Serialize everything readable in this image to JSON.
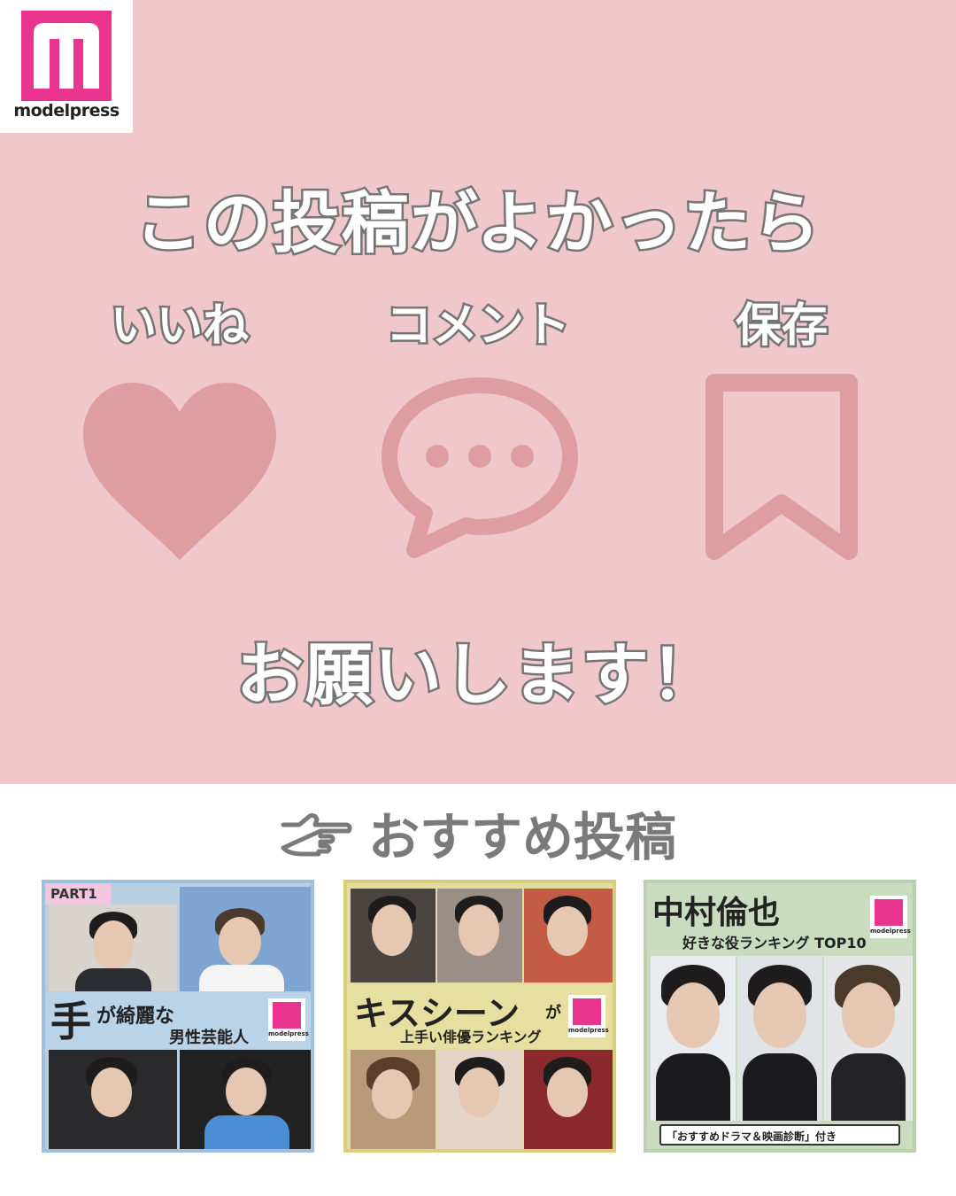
{
  "brand": {
    "logo_text": "modelpress",
    "accent": "#e8348f"
  },
  "cta": {
    "headline": "この投稿がよかったら",
    "actions": [
      {
        "label": "いいね",
        "icon": "heart-icon"
      },
      {
        "label": "コメント",
        "icon": "speech-bubble-icon"
      },
      {
        "label": "保存",
        "icon": "bookmark-icon"
      }
    ],
    "closing": "お願いします！"
  },
  "recommended": {
    "title": "おすすめ投稿",
    "icon": "pointing-hand-icon",
    "posts": [
      {
        "tag": "PART1",
        "title_big": "手",
        "title_rest": "が綺麗な",
        "subtitle": "男性芸能人"
      },
      {
        "title_big": "キスシーン",
        "title_rest": "が",
        "subtitle": "上手い俳優ランキング"
      },
      {
        "title_big": "中村倫也",
        "subtitle": "好きな役ランキング TOP10",
        "footer": "「おすすめドラマ＆映画診断」付き"
      }
    ]
  },
  "colors": {
    "top_bg": "#f0c8cb",
    "icon_pink": "#de9da0",
    "outline_gray": "#757575"
  }
}
